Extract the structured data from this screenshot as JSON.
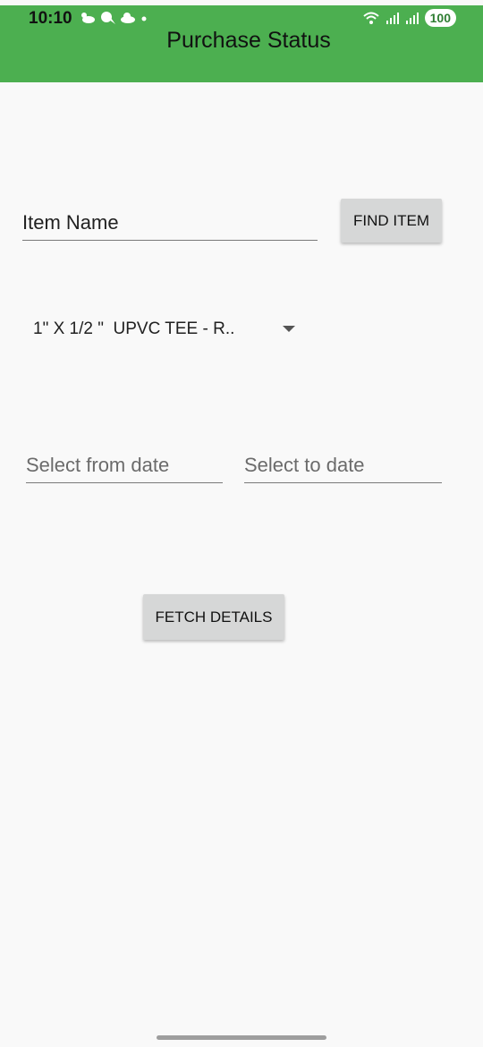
{
  "status_bar": {
    "time": "10:10",
    "battery": "100",
    "icons_left": [
      "weather-icon",
      "notification-icon",
      "cloud-icon",
      "dot-icon"
    ],
    "icons_right": [
      "wifi-icon",
      "signal-icon",
      "signal-icon"
    ]
  },
  "header": {
    "title": "Purchase Status",
    "color": "#4caf50"
  },
  "form": {
    "item_name_placeholder": "Item Name",
    "find_item_label": "FIND ITEM",
    "spinner_value": "1\" X 1/2 \"  UPVC TEE - R..",
    "from_date_placeholder": "Select from date",
    "to_date_placeholder": "Select to date",
    "fetch_details_label": "FETCH DETAILS"
  }
}
